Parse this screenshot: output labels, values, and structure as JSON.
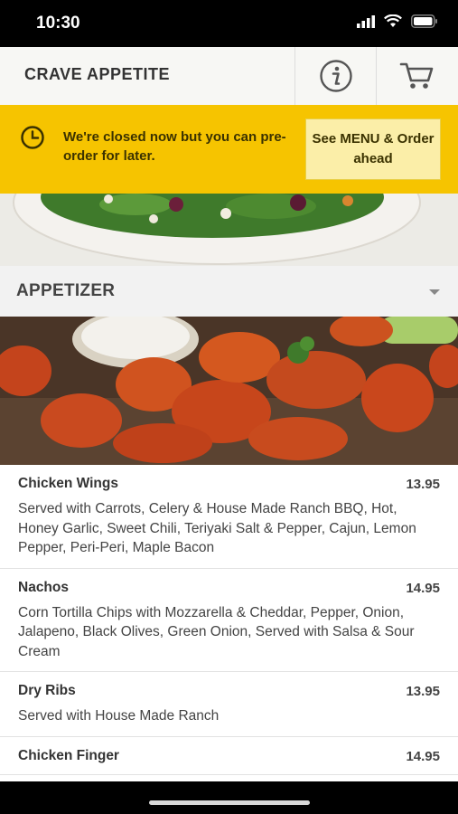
{
  "status_bar": {
    "time": "10:30"
  },
  "header": {
    "brand": "CRAVE APPETITE",
    "info_icon": "info-icon",
    "cart_icon": "cart-icon"
  },
  "banner": {
    "message": "We're closed now but you can pre-order for later.",
    "button_label": "See MENU & Order ahead",
    "color": "#f6c400"
  },
  "section": {
    "title": "APPETIZER"
  },
  "menu_items": [
    {
      "name": "Chicken Wings",
      "price": "13.95",
      "description": "Served with Carrots, Celery & House Made Ranch BBQ, Hot, Honey Garlic, Sweet Chili, Teriyaki Salt & Pepper, Cajun, Lemon Pepper, Peri-Peri, Maple Bacon"
    },
    {
      "name": "Nachos",
      "price": "14.95",
      "description": "Corn Tortilla Chips with Mozzarella & Cheddar, Pepper, Onion, Jalapeno, Black Olives, Green Onion, Served with Salsa & Sour Cream"
    },
    {
      "name": "Dry Ribs",
      "price": "13.95",
      "description": "Served with House Made Ranch"
    },
    {
      "name": "Chicken Finger",
      "price": "14.95",
      "description": ""
    }
  ]
}
